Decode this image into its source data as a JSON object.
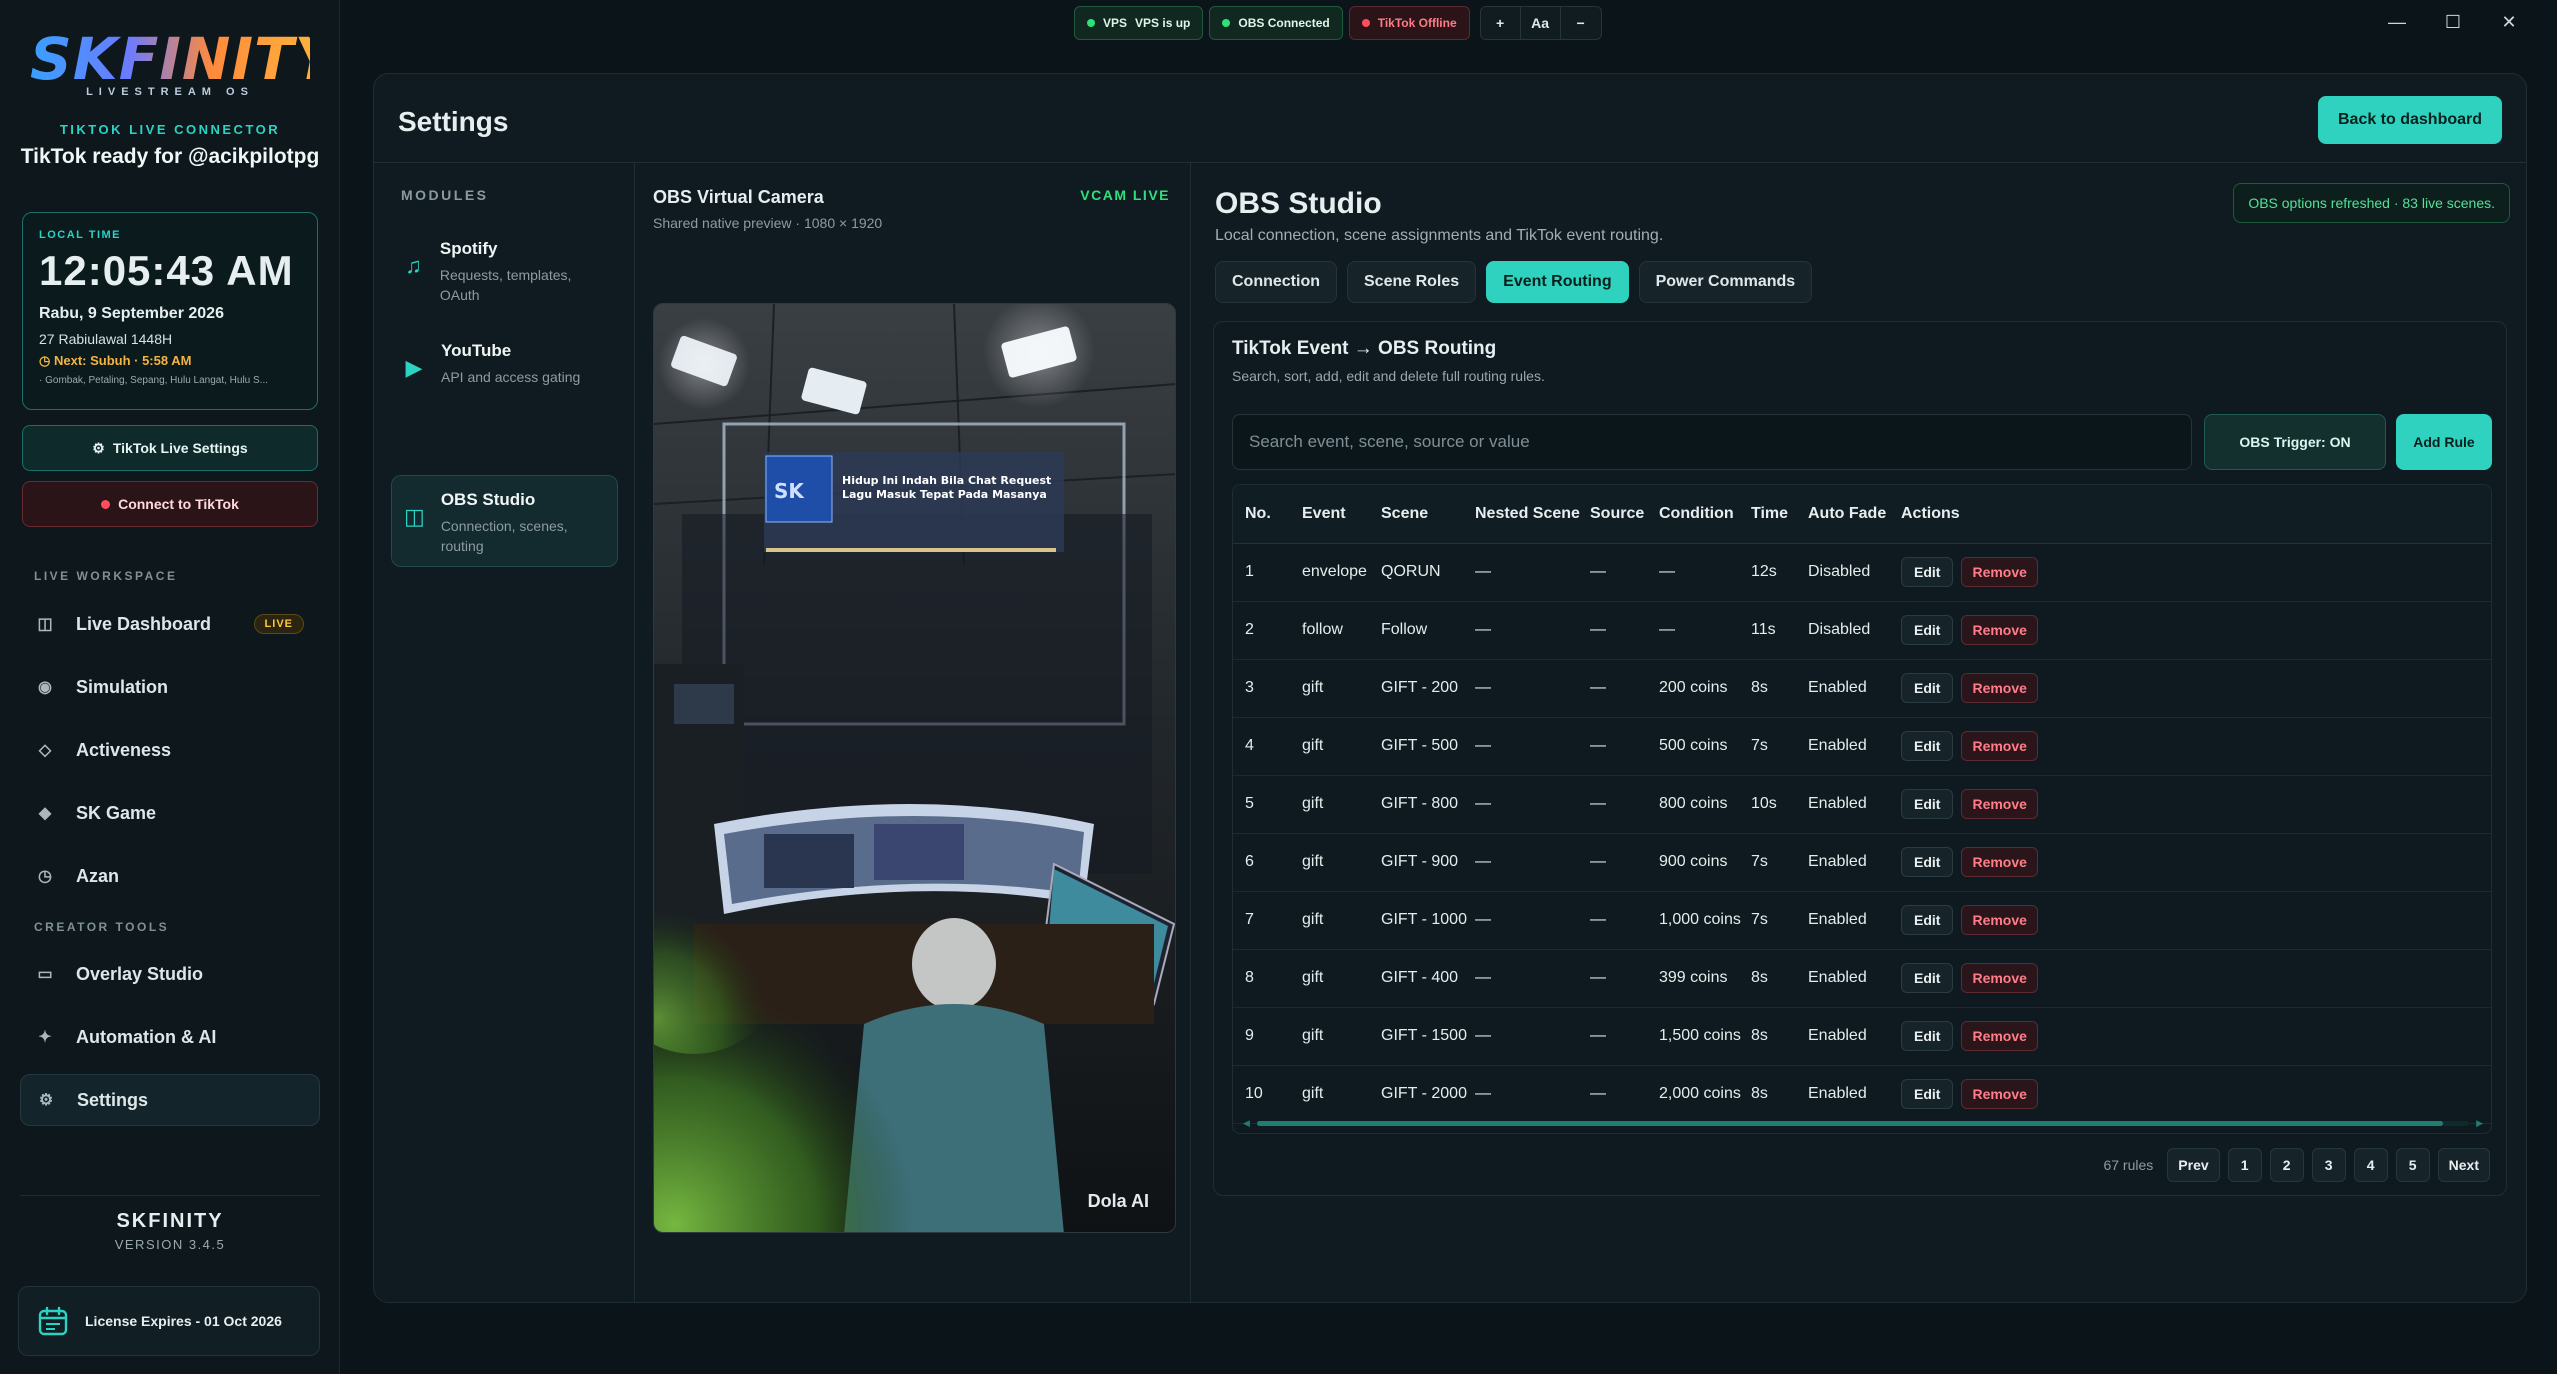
{
  "sidebar": {
    "logo_text": "SKFINITY",
    "logo_sub": "LIVESTREAM OS",
    "connector_label": "TIKTOK LIVE CONNECTOR",
    "ready_text": "TikTok ready for @acikpilotpg",
    "clock": {
      "label": "LOCAL TIME",
      "time": "12:05:43 AM",
      "date": "Rabu, 9 September 2026",
      "hijri": "27 Rabiulawal 1448H",
      "next_prayer": "Next: Subuh · 5:58 AM",
      "zones": "· Gombak, Petaling, Sepang, Hulu Langat, Hulu S..."
    },
    "tiktok_settings_label": "TikTok Live Settings",
    "connect_label": "Connect to TikTok",
    "live_workspace_label": "LIVE WORKSPACE",
    "creator_tools_label": "CREATOR TOOLS",
    "nav": {
      "live_dashboard": "Live Dashboard",
      "live_badge": "LIVE",
      "simulation": "Simulation",
      "activeness": "Activeness",
      "sk_game": "SK Game",
      "azan": "Azan",
      "overlay_studio": "Overlay Studio",
      "automation_ai": "Automation & AI",
      "settings": "Settings"
    },
    "brand_name": "SKFINITY",
    "version": "VERSION 3.4.5",
    "license": "License Expires - 01 Oct 2026"
  },
  "topbar": {
    "vps_label": "VPS",
    "vps_status": "VPS is up",
    "obs_status": "OBS Connected",
    "tiktok_status": "TikTok Offline",
    "zoom_in": "+",
    "font_label": "Aa",
    "zoom_out": "−"
  },
  "settings": {
    "title": "Settings",
    "back_button": "Back to dashboard",
    "modules_label": "MODULES",
    "modules": [
      {
        "title": "Spotify",
        "desc": "Requests, templates, OAuth"
      },
      {
        "title": "YouTube",
        "desc": "API and access gating"
      },
      {
        "title": "OBS Studio",
        "desc": "Connection, scenes, routing"
      }
    ],
    "vcam": {
      "title": "OBS Virtual Camera",
      "subtitle": "Shared native preview · 1080 × 1920",
      "status": "VCAM LIVE",
      "watermark": "Dola AI",
      "overlay_title": "Hidup Ini Indah Bila Chat Request Lagu Masuk Tepat Pada Masanya"
    },
    "obs": {
      "title": "OBS Studio",
      "subtitle": "Local connection, scene assignments and TikTok event routing.",
      "notice": "OBS options refreshed · 83 live scenes.",
      "tabs": [
        "Connection",
        "Scene Roles",
        "Event Routing",
        "Power Commands"
      ],
      "routing_title": "TikTok Event → OBS Routing",
      "routing_subtitle": "Search, sort, add, edit and delete full routing rules.",
      "search_placeholder": "Search event, scene, source or value",
      "trigger_label": "OBS Trigger: ON",
      "add_rule_label": "Add Rule",
      "columns": [
        "No.",
        "Event",
        "Scene",
        "Nested Scene",
        "Source",
        "Condition",
        "Time",
        "Auto Fade",
        "Actions"
      ],
      "edit_label": "Edit",
      "remove_label": "Remove",
      "rows": [
        {
          "no": "1",
          "event": "envelope",
          "scene": "QORUN",
          "nested": "—",
          "source": "—",
          "condition": "—",
          "time": "12s",
          "fade": "Disabled"
        },
        {
          "no": "2",
          "event": "follow",
          "scene": "Follow",
          "nested": "—",
          "source": "—",
          "condition": "—",
          "time": "11s",
          "fade": "Disabled"
        },
        {
          "no": "3",
          "event": "gift",
          "scene": "GIFT - 200",
          "nested": "—",
          "source": "—",
          "condition": "200 coins",
          "time": "8s",
          "fade": "Enabled"
        },
        {
          "no": "4",
          "event": "gift",
          "scene": "GIFT - 500",
          "nested": "—",
          "source": "—",
          "condition": "500 coins",
          "time": "7s",
          "fade": "Enabled"
        },
        {
          "no": "5",
          "event": "gift",
          "scene": "GIFT - 800",
          "nested": "—",
          "source": "—",
          "condition": "800 coins",
          "time": "10s",
          "fade": "Enabled"
        },
        {
          "no": "6",
          "event": "gift",
          "scene": "GIFT - 900",
          "nested": "—",
          "source": "—",
          "condition": "900 coins",
          "time": "7s",
          "fade": "Enabled"
        },
        {
          "no": "7",
          "event": "gift",
          "scene": "GIFT - 1000",
          "nested": "—",
          "source": "—",
          "condition": "1,000 coins",
          "time": "7s",
          "fade": "Enabled"
        },
        {
          "no": "8",
          "event": "gift",
          "scene": "GIFT - 400",
          "nested": "—",
          "source": "—",
          "condition": "399 coins",
          "time": "8s",
          "fade": "Enabled"
        },
        {
          "no": "9",
          "event": "gift",
          "scene": "GIFT - 1500",
          "nested": "—",
          "source": "—",
          "condition": "1,500 coins",
          "time": "8s",
          "fade": "Enabled"
        },
        {
          "no": "10",
          "event": "gift",
          "scene": "GIFT - 2000",
          "nested": "—",
          "source": "—",
          "condition": "2,000 coins",
          "time": "8s",
          "fade": "Enabled"
        }
      ],
      "pagination": {
        "count": "67 rules",
        "prev": "Prev",
        "pages": [
          "1",
          "2",
          "3",
          "4",
          "5"
        ],
        "next": "Next"
      }
    }
  },
  "colors": {
    "accent": "#2fd2bf",
    "live_green": "#2ee07a",
    "danger": "#ff4d5e",
    "warning": "#f5b342"
  }
}
